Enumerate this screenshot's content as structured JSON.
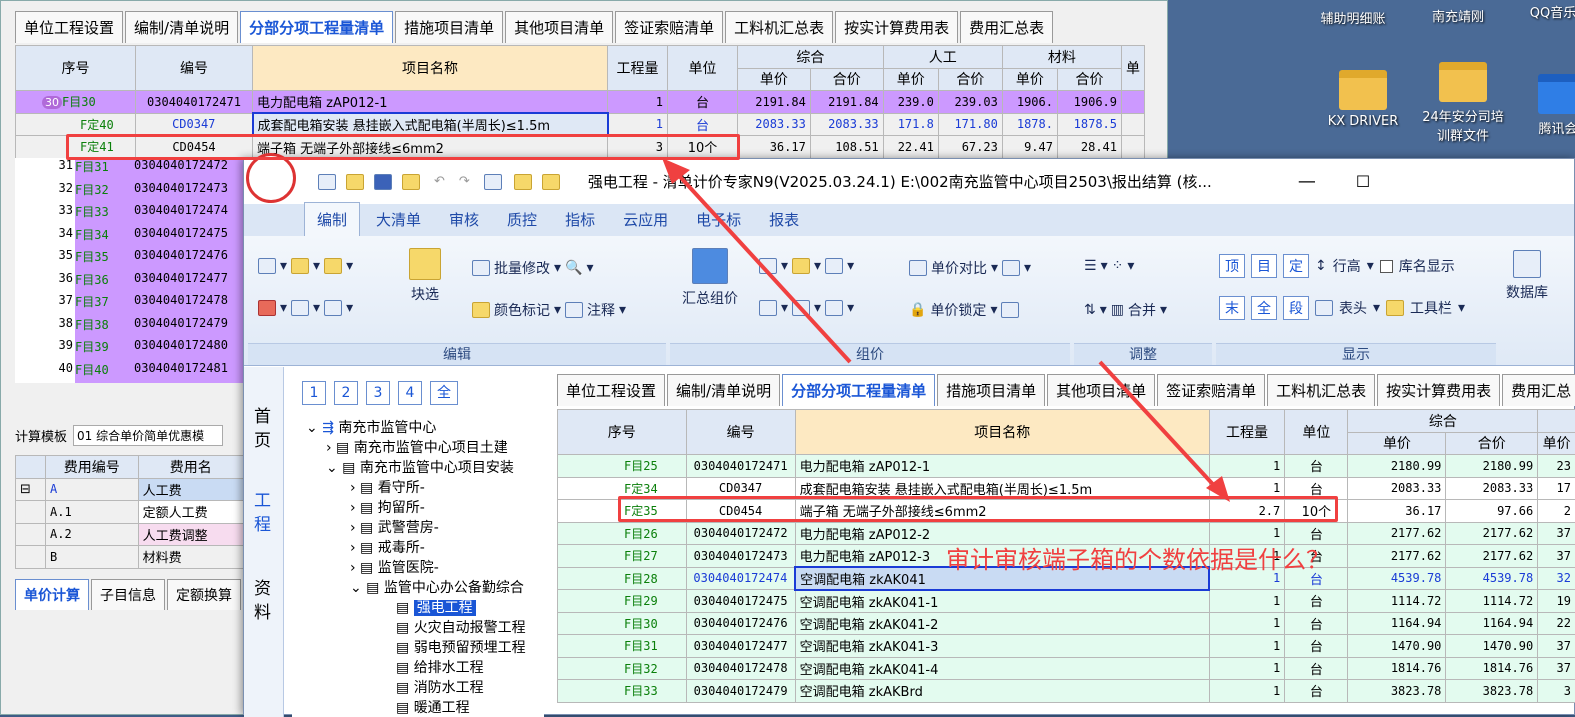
{
  "desktop": {
    "icons": [
      {
        "label": "辅助明细账"
      },
      {
        "label": "南充靖刚"
      },
      {
        "label": "QQ音乐"
      },
      {
        "label": "KX DRIVER"
      },
      {
        "label": "24年安分司培训群文件"
      },
      {
        "label": "腾讯会"
      }
    ]
  },
  "back": {
    "tabs": [
      "单位工程设置",
      "编制/清单说明",
      "分部分项工程量清单",
      "措施项目清单",
      "其他项目清单",
      "签证索赔清单",
      "工料机汇总表",
      "按实计算费用表",
      "费用汇总表"
    ],
    "headers": {
      "seq": "序号",
      "code": "编号",
      "name": "项目名称",
      "qty": "工程量",
      "unit": "单位",
      "zonghe": "综合",
      "rengong": "人工",
      "cailiao": "材料",
      "danjia": "单价",
      "hejia": "合价",
      "dan": "单"
    },
    "rows": [
      {
        "seq": "F目30",
        "code": "0304040172471",
        "name": "电力配电箱 zAP012-1",
        "qty": "1",
        "unit": "台",
        "p1": "2191.84",
        "p2": "2191.84",
        "p3": "239.0",
        "p4": "239.03",
        "p5": "1906.",
        "p6": "1906.9"
      },
      {
        "seq": "F定40",
        "code": "CD0347",
        "name": "成套配电箱安装 悬挂嵌入式配电箱(半周长)≤1.5m",
        "qty": "1",
        "unit": "台",
        "p1": "2083.33",
        "p2": "2083.33",
        "p3": "171.8",
        "p4": "171.80",
        "p5": "1878.",
        "p6": "1878.5"
      },
      {
        "seq": "F定41",
        "code": "CD0454",
        "name": "端子箱 无端子外部接线≤6mm2",
        "qty": "3",
        "unit": "10个",
        "p1": "36.17",
        "p2": "108.51",
        "p3": "22.41",
        "p4": "67.23",
        "p5": "9.47",
        "p6": "28.41"
      },
      {
        "seq": "F目31",
        "code": "0304040172472"
      },
      {
        "seq": "F目32",
        "code": "0304040172473"
      },
      {
        "seq": "F目33",
        "code": "0304040172474"
      },
      {
        "seq": "F目34",
        "code": "0304040172475"
      },
      {
        "seq": "F目35",
        "code": "0304040172476"
      },
      {
        "seq": "F目36",
        "code": "0304040172477"
      },
      {
        "seq": "F目37",
        "code": "0304040172478"
      },
      {
        "seq": "F目38",
        "code": "0304040172479"
      },
      {
        "seq": "F目39",
        "code": "0304040172480"
      },
      {
        "seq": "F目40",
        "code": "0304040172481"
      }
    ],
    "badges": [
      "30",
      "31",
      "32",
      "33",
      "34",
      "35",
      "36",
      "37",
      "38",
      "39",
      "40"
    ],
    "calc_template_label": "计算模板",
    "calc_template_value": "01 综合单价简单优惠模",
    "fee_headers": [
      "费用编号",
      "费用名"
    ],
    "fees": [
      {
        "code": "A",
        "name": "人工费"
      },
      {
        "code": "A.1",
        "name": "定额人工费"
      },
      {
        "code": "A.2",
        "name": "人工费调整"
      },
      {
        "code": "B",
        "name": "材料费"
      }
    ],
    "bottom_tabs": [
      "单价计算",
      "子目信息",
      "定额换算"
    ]
  },
  "front": {
    "title": "强电工程 - 清单计价专家N9(V2025.03.24.1) E:\\002南充监管中心项目2503\\报出结算 (核...",
    "ribbon_tabs": [
      "编制",
      "大清单",
      "审核",
      "质控",
      "指标",
      "云应用",
      "电子标",
      "报表"
    ],
    "ribbon": {
      "block_select": "块选",
      "batch_modify": "批量修改",
      "color_mark": "颜色标记",
      "annotate": "注释",
      "summary_price": "汇总组价",
      "price_compare": "单价对比",
      "price_lock": "单价锁定",
      "row_height": "行高",
      "lib_name": "库名显示",
      "merge": "合并",
      "header": "表头",
      "toolbar": "工具栏",
      "database": "数据库",
      "top": "顶",
      "mu": "目",
      "ding": "定",
      "wei": "末",
      "quan": "全",
      "duan": "段"
    },
    "groups": [
      "编辑",
      "组价",
      "调整",
      "显示"
    ],
    "side_tabs": [
      "首页",
      "工程",
      "资料"
    ],
    "level_btns": [
      "1",
      "2",
      "3",
      "4",
      "全"
    ],
    "tree": [
      "南充市监管中心",
      "南充市监管中心项目土建",
      "南充市监管中心项目安装",
      "看守所-",
      "拘留所-",
      "武警营房-",
      "戒毒所-",
      "监管医院-",
      "监管中心办公备勤综合",
      "强电工程",
      "火灾自动报警工程",
      "弱电预留预埋工程",
      "给排水工程",
      "消防水工程",
      "暖通工程"
    ],
    "tabs": [
      "单位工程设置",
      "编制/清单说明",
      "分部分项工程量清单",
      "措施项目清单",
      "其他项目清单",
      "签证索赔清单",
      "工料机汇总表",
      "按实计算费用表",
      "费用汇总"
    ],
    "headers": {
      "seq": "序号",
      "code": "编号",
      "name": "项目名称",
      "qty": "工程量",
      "unit": "单位",
      "zonghe": "综合",
      "danjia": "单价",
      "hejia": "合价",
      "dan": "单价"
    },
    "rows": [
      {
        "seq": "F目25",
        "code": "0304040172471",
        "name": "电力配电箱 zAP012-1",
        "qty": "1",
        "unit": "台",
        "p1": "2180.99",
        "p2": "2180.99",
        "p3": "23"
      },
      {
        "seq": "F定34",
        "code": "CD0347",
        "name": "成套配电箱安装 悬挂嵌入式配电箱(半周长)≤1.5m",
        "qty": "1",
        "unit": "台",
        "p1": "2083.33",
        "p2": "2083.33",
        "p3": "17"
      },
      {
        "seq": "F定35",
        "code": "CD0454",
        "name": "端子箱 无端子外部接线≤6mm2",
        "qty": "2.7",
        "unit": "10个",
        "p1": "36.17",
        "p2": "97.66",
        "p3": "2"
      },
      {
        "seq": "F目26",
        "code": "0304040172472",
        "name": "电力配电箱 zAP012-2",
        "qty": "1",
        "unit": "台",
        "p1": "2177.62",
        "p2": "2177.62",
        "p3": "37"
      },
      {
        "seq": "F目27",
        "code": "0304040172473",
        "name": "电力配电箱 zAP012-3",
        "qty": "1",
        "unit": "台",
        "p1": "2177.62",
        "p2": "2177.62",
        "p3": "37"
      },
      {
        "seq": "F目28",
        "code": "0304040172474",
        "name": "空调配电箱 zkAK041",
        "qty": "1",
        "unit": "台",
        "p1": "4539.78",
        "p2": "4539.78",
        "p3": "32"
      },
      {
        "seq": "F目29",
        "code": "0304040172475",
        "name": "空调配电箱 zkAK041-1",
        "qty": "1",
        "unit": "台",
        "p1": "1114.72",
        "p2": "1114.72",
        "p3": "19"
      },
      {
        "seq": "F目30",
        "code": "0304040172476",
        "name": "空调配电箱 zkAK041-2",
        "qty": "1",
        "unit": "台",
        "p1": "1164.94",
        "p2": "1164.94",
        "p3": "22"
      },
      {
        "seq": "F目31",
        "code": "0304040172477",
        "name": "空调配电箱 zkAK041-3",
        "qty": "1",
        "unit": "台",
        "p1": "1470.90",
        "p2": "1470.90",
        "p3": "37"
      },
      {
        "seq": "F目32",
        "code": "0304040172478",
        "name": "空调配电箱 zkAK041-4",
        "qty": "1",
        "unit": "台",
        "p1": "1814.76",
        "p2": "1814.76",
        "p3": "37"
      },
      {
        "seq": "F目33",
        "code": "0304040172479",
        "name": "空调配电箱 zkAKBrd",
        "qty": "1",
        "unit": "台",
        "p1": "3823.78",
        "p2": "3823.78",
        "p3": "3"
      }
    ]
  },
  "annotation": {
    "text": "审计审核端子箱的个数依据是什么？",
    "color": "#f04040"
  }
}
